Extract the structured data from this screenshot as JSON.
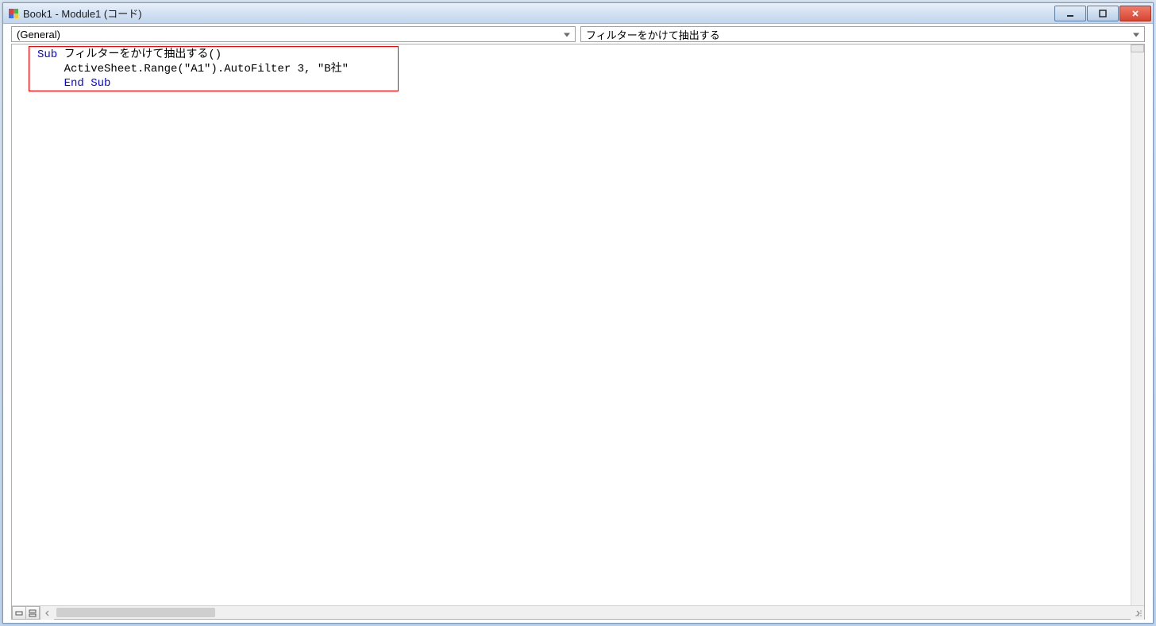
{
  "window": {
    "title": "Book1 - Module1 (コード)"
  },
  "dropdowns": {
    "scope": "(General)",
    "procedure": "フィルターをかけて抽出する"
  },
  "code": {
    "line1_kw": "Sub",
    "line1_name": " フィルターをかけて抽出する()",
    "line2": "    ActiveSheet.Range(\"A1\").AutoFilter 3, \"B社\"",
    "line3": "    End Sub"
  },
  "colors": {
    "keyword": "#0000ff",
    "highlight_border": "#ff0000"
  }
}
